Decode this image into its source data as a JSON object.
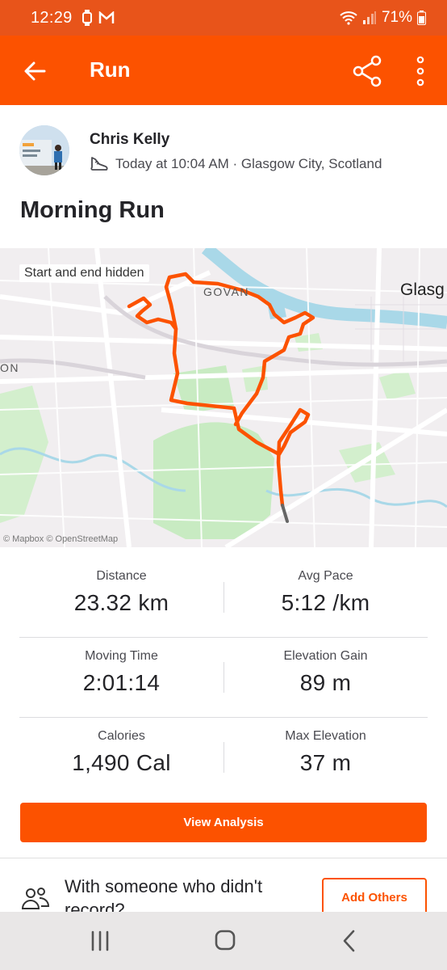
{
  "status_bar": {
    "time": "12:29",
    "battery": "71%"
  },
  "app_bar": {
    "title": "Run",
    "icons": [
      "back-arrow-icon",
      "share-icon",
      "more-vertical-icon"
    ]
  },
  "athlete": {
    "name": "Chris Kelly",
    "activity_meta": "Today at 10:04 AM · Glasgow City, Scotland",
    "sport_icon": "running-shoe-icon"
  },
  "activity": {
    "title": "Morning Run"
  },
  "map": {
    "badge": "Start and end hidden",
    "place_govan": "GOVAN",
    "place_glasgow": "Glasg",
    "place_edge": "ON",
    "attribution": "© Mapbox © OpenStreetMap",
    "route_color": "#fc5200",
    "hidden_segment_color": "#666666"
  },
  "stats": [
    {
      "label": "Distance",
      "value": "23.32 km"
    },
    {
      "label": "Avg Pace",
      "value": "5:12 /km"
    },
    {
      "label": "Moving Time",
      "value": "2:01:14"
    },
    {
      "label": "Elevation Gain",
      "value": "89 m"
    },
    {
      "label": "Calories",
      "value": "1,490 Cal"
    },
    {
      "label": "Max Elevation",
      "value": "37 m"
    }
  ],
  "actions": {
    "view_analysis": "View Analysis",
    "with_someone_text": "With someone who didn't record?",
    "add_others": "Add Others"
  },
  "colors": {
    "brand": "#fc5200",
    "status_bar": "#e8541a"
  }
}
